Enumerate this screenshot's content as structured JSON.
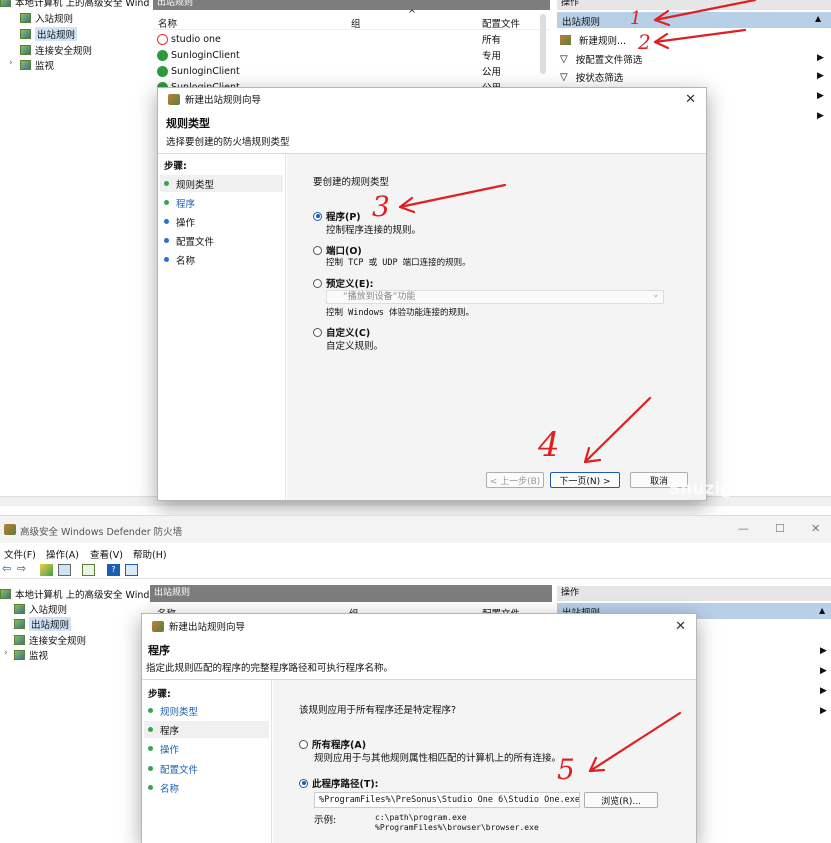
{
  "top": {
    "tree": {
      "root": "本地计算机 上的高级安全 Wind",
      "items": [
        "入站规则",
        "出站规则",
        "连接安全规则",
        "监视"
      ]
    },
    "middle": {
      "header": "出站规则",
      "columns": [
        "名称",
        "组",
        "配置文件"
      ],
      "rows": [
        {
          "name": "studio one",
          "profile": "所有"
        },
        {
          "name": "SunloginClient",
          "profile": "专用"
        },
        {
          "name": "SunloginClient",
          "profile": "公用"
        },
        {
          "name": "SunloginClient",
          "profile": "公用"
        }
      ]
    },
    "actions": {
      "header": "操作",
      "section": "出站规则",
      "items": [
        "新建规则...",
        "按配置文件筛选",
        "按状态筛选"
      ]
    },
    "dialog": {
      "title": "新建出站规则向导",
      "heading": "规则类型",
      "subheading": "选择要创建的防火墙规则类型",
      "steps_title": "步骤:",
      "steps": [
        "规则类型",
        "程序",
        "操作",
        "配置文件",
        "名称"
      ],
      "prompt": "要创建的规则类型",
      "options": [
        {
          "label": "程序(P)",
          "desc": "控制程序连接的规则。"
        },
        {
          "label": "端口(O)",
          "desc": "控制 TCP 或 UDP 端口连接的规则。"
        },
        {
          "label": "预定义(E):",
          "desc": "控制 Windows 体验功能连接的规则。"
        },
        {
          "label": "自定义(C)",
          "desc": "自定义规则。"
        }
      ],
      "predefined_value": "“播放到设备”功能",
      "back": "< 上一步(B)",
      "next": "下一页(N) >",
      "cancel": "取消"
    },
    "annotations": {
      "a1": "1",
      "a2": "2",
      "a3": "3",
      "a4": "4"
    },
    "watermark": "Shuzigu..."
  },
  "bottom": {
    "app_title": "高级安全 Windows Defender 防火墙",
    "window_controls": {
      "min": "—",
      "max": "☐",
      "close": "✕"
    },
    "menu": [
      "文件(F)",
      "操作(A)",
      "查看(V)",
      "帮助(H)"
    ],
    "tree": {
      "root": "本地计算机 上的高级安全 Wind",
      "items": [
        "入站规则",
        "出站规则",
        "连接安全规则",
        "监视"
      ]
    },
    "middle_header": "出站规则",
    "columns": [
      "名称",
      "组",
      "配置文件"
    ],
    "actions_header": "操作",
    "actions_section": "出站规则",
    "dialog": {
      "title": "新建出站规则向导",
      "heading": "程序",
      "subheading": "指定此规则匹配的程序的完整程序路径和可执行程序名称。",
      "steps_title": "步骤:",
      "steps": [
        "规则类型",
        "程序",
        "操作",
        "配置文件",
        "名称"
      ],
      "prompt": "该规则应用于所有程序还是特定程序?",
      "all_programs": "所有程序(A)",
      "all_programs_desc": "规则应用于与其他规则属性相匹配的计算机上的所有连接。",
      "this_path": "此程序路径(T):",
      "path_value": "%ProgramFiles%\\PreSonus\\Studio One 6\\Studio One.exe",
      "browse": "浏览(R)...",
      "example_label": "示例:",
      "example_1": "c:\\path\\program.exe",
      "example_2": "%ProgramFiles%\\browser\\browser.exe"
    },
    "annotations": {
      "a5": "5"
    }
  }
}
